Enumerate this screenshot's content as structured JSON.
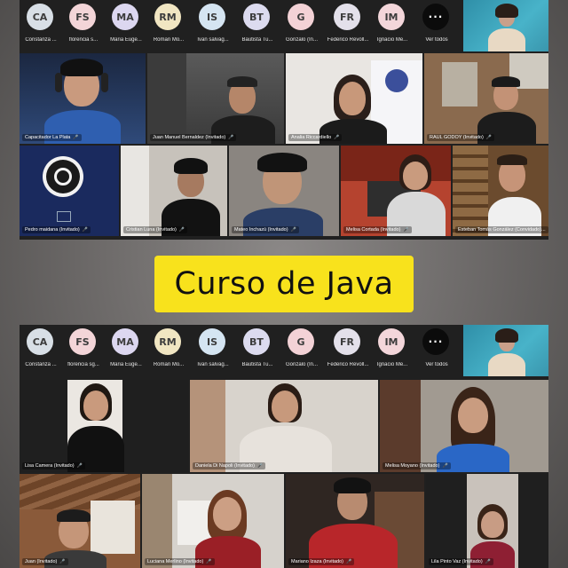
{
  "banner": {
    "title": "Curso de Java"
  },
  "top": {
    "participants": [
      {
        "initials": "CA",
        "name": "Constanza ...",
        "color": "#d8dfe6"
      },
      {
        "initials": "FS",
        "name": "florencia s...",
        "color": "#f3d5d8"
      },
      {
        "initials": "MA",
        "name": "Maria Euge...",
        "color": "#dcd7f0"
      },
      {
        "initials": "RM",
        "name": "Roman Mo...",
        "color": "#f1e6c2"
      },
      {
        "initials": "IS",
        "name": "Ivan salvag...",
        "color": "#d5e5f2"
      },
      {
        "initials": "BT",
        "name": "Bautista Tu...",
        "color": "#dcdbef"
      },
      {
        "initials": "G",
        "name": "Gonzalo (In...",
        "color": "#f3d2d6"
      },
      {
        "initials": "FR",
        "name": "Federico Revoll...",
        "color": "#e3e0ea"
      },
      {
        "initials": "IM",
        "name": "Ignacio Me...",
        "color": "#f3d6da"
      }
    ],
    "more": {
      "icon": "···",
      "label": "Ver todos"
    },
    "tiles": [
      {
        "label": "Capacitador La Plata"
      },
      {
        "label": "Juan Manuel Bernaldez (Invitado)"
      },
      {
        "label": "Analia Riccardiello"
      },
      {
        "label": "RAUL GODOY (Invitado)"
      },
      {
        "label": "Pedro maidana (Invitado)"
      },
      {
        "label": "Cristian Luna (Invitado)"
      },
      {
        "label": "Mateo Inchazú (Invitado)"
      },
      {
        "label": "Melisa Cortada (Invitado)"
      },
      {
        "label": "Esteban Tomás González (Convidado)..."
      }
    ]
  },
  "bottom": {
    "participants": [
      {
        "initials": "CA",
        "name": "Constanza ...",
        "color": "#d8dfe6"
      },
      {
        "initials": "FS",
        "name": "florencia sg...",
        "color": "#f3d5d8"
      },
      {
        "initials": "MA",
        "name": "Maria Euge...",
        "color": "#dcd7f0"
      },
      {
        "initials": "RM",
        "name": "Roman Mo...",
        "color": "#f1e6c2"
      },
      {
        "initials": "IS",
        "name": "Ivan salvag...",
        "color": "#d5e5f2"
      },
      {
        "initials": "BT",
        "name": "Bautista Tu...",
        "color": "#dcdbef"
      },
      {
        "initials": "G",
        "name": "Gonzalo (In...",
        "color": "#f3d2d6"
      },
      {
        "initials": "FR",
        "name": "Federico Revoll...",
        "color": "#e3e0ea"
      },
      {
        "initials": "IM",
        "name": "Ignacio Me...",
        "color": "#f3d6da"
      }
    ],
    "more": {
      "icon": "···",
      "label": "Ver todos"
    },
    "tiles": [
      {
        "label": "Lisa Camera (Invitado)"
      },
      {
        "label": "Daniela Di Napoli (Invitado)"
      },
      {
        "label": "Melisa Moyano (Invitado)"
      },
      {
        "label": "Juan (Invitado)"
      },
      {
        "label": "Luciana Merlino (Invitado)"
      },
      {
        "label": "Mariano Izaza (Invitado)"
      },
      {
        "label": "Lila Pinto Vaz (Invitado)"
      }
    ]
  },
  "icons": {
    "mic": "microphone-icon",
    "logo": "obs-logo-icon",
    "screen": "screen-share-icon"
  }
}
